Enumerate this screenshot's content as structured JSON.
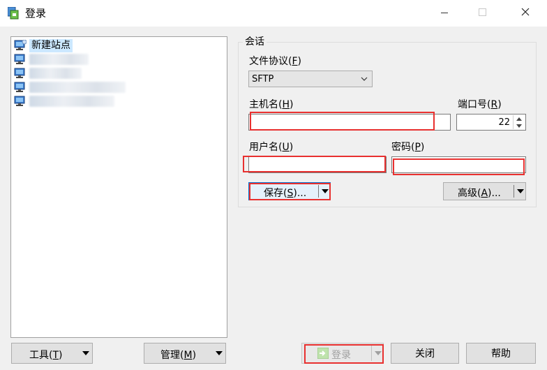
{
  "window": {
    "title": "登录",
    "minimize_icon": "minimize-icon",
    "maximize_icon": "maximize-icon",
    "close_icon": "close-icon"
  },
  "site_tree": {
    "items": [
      {
        "label": "新建站点",
        "selected": true,
        "icon": "computer-icon"
      },
      {
        "label": "",
        "blurred": true,
        "icon": "computer-icon"
      },
      {
        "label": "",
        "blurred": true,
        "icon": "computer-icon"
      },
      {
        "label": "",
        "blurred": true,
        "icon": "computer-icon"
      },
      {
        "label": "",
        "blurred": true,
        "icon": "computer-icon"
      }
    ]
  },
  "session": {
    "group_title": "会话",
    "protocol_label": "文件协议",
    "protocol_key": "F",
    "protocol_value": "SFTP",
    "host_label": "主机名",
    "host_key": "H",
    "host_value": "",
    "port_label": "端口号",
    "port_key": "R",
    "port_value": "22",
    "user_label": "用户名",
    "user_key": "U",
    "user_value": "",
    "password_label": "密码",
    "password_key": "P",
    "password_value": "",
    "save_label": "保存",
    "save_key": "S",
    "save_ellipsis": "...",
    "advanced_label": "高级",
    "advanced_key": "A",
    "advanced_ellipsis": "..."
  },
  "footer": {
    "tools_label": "工具",
    "tools_key": "T",
    "manage_label": "管理",
    "manage_key": "M",
    "login_label": "登录",
    "close_label": "关闭",
    "help_label": "帮助"
  },
  "colors": {
    "highlight_red": "#e8302f",
    "focus_blue": "#0078d7",
    "selection": "#cce8ff"
  }
}
